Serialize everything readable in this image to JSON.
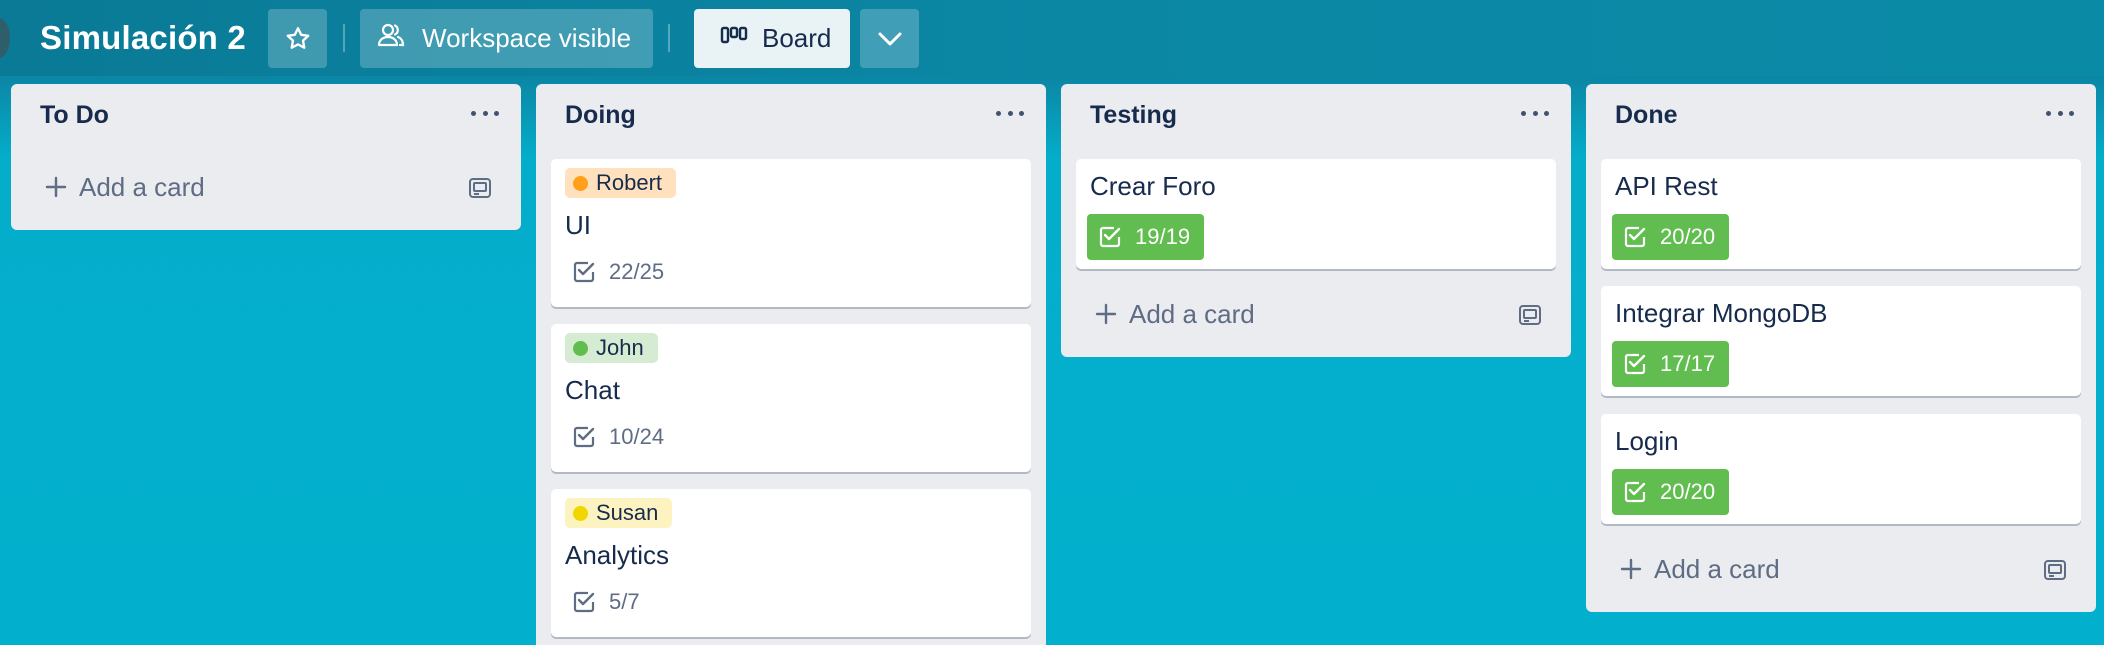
{
  "header": {
    "board_title": "Simulación 2",
    "visibility_label": "Workspace visible",
    "view_label": "Board",
    "icons": {
      "star": "star-icon",
      "visibility": "people-icon",
      "view": "board-icon",
      "menu": "chevron-down-icon"
    }
  },
  "lists": [
    {
      "title": "To Do",
      "cards": [],
      "add_card_label": "Add a card"
    },
    {
      "title": "Doing",
      "cards": [
        {
          "label": "Robert",
          "label_color": "#ff9f1a",
          "title": "UI",
          "checklist": "22/25"
        },
        {
          "label": "John",
          "label_color": "#61bd4f",
          "title": "Chat",
          "checklist": "10/24"
        },
        {
          "label": "Susan",
          "label_color": "#f2d600",
          "title": "Analytics",
          "checklist": "5/7"
        }
      ]
    },
    {
      "title": "Testing",
      "cards": [
        {
          "title": "Crear Foro",
          "checklist": "19/19",
          "complete": true
        }
      ],
      "add_card_label": "Add a card"
    },
    {
      "title": "Done",
      "cards": [
        {
          "title": "API Rest",
          "checklist": "20/20",
          "complete": true
        },
        {
          "title": "Integrar MongoDB",
          "checklist": "17/17",
          "complete": true
        },
        {
          "title": "Login",
          "checklist": "20/20",
          "complete": true
        }
      ],
      "add_card_label": "Add a card"
    }
  ],
  "colors": {
    "header_bg": "#0b87a4",
    "board_bg": "#02b0cd",
    "list_bg": "#ebecf0",
    "complete_badge": "#61bd4f",
    "text_dark": "#172b4d",
    "text_muted": "#5e6c84"
  }
}
